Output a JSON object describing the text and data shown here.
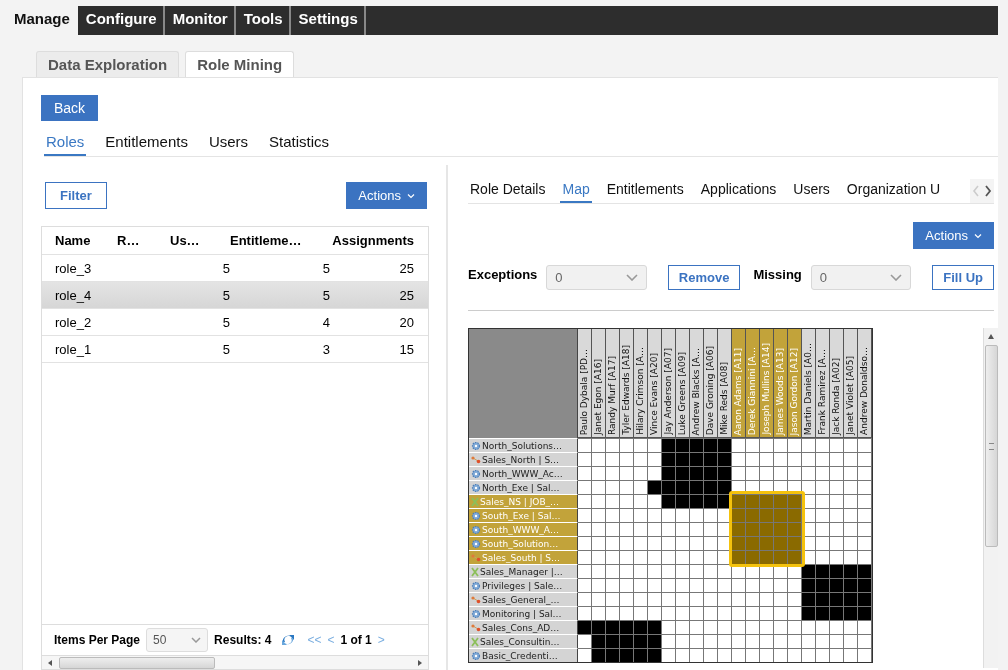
{
  "top_nav": [
    {
      "label": "Manage",
      "selected": true
    },
    {
      "label": "Configure",
      "selected": false
    },
    {
      "label": "Monitor",
      "selected": false
    },
    {
      "label": "Tools",
      "selected": false
    },
    {
      "label": "Settings",
      "selected": false
    }
  ],
  "sub_tabs": [
    {
      "label": "Data Exploration",
      "selected": false
    },
    {
      "label": "Role Mining",
      "selected": true
    }
  ],
  "back_button": "Back",
  "section_tabs": [
    {
      "label": "Roles",
      "selected": true
    },
    {
      "label": "Entitlements",
      "selected": false
    },
    {
      "label": "Users",
      "selected": false
    },
    {
      "label": "Statistics",
      "selected": false
    }
  ],
  "roles_panel": {
    "filter_button": "Filter",
    "actions_button": "Actions",
    "table": {
      "columns": [
        "Name",
        "R…",
        "Us…",
        "Entitleme…",
        "Assignments"
      ],
      "rows": [
        {
          "cells": [
            "role_3",
            "",
            "5",
            "5",
            "25"
          ],
          "selected": false
        },
        {
          "cells": [
            "role_4",
            "",
            "5",
            "5",
            "25"
          ],
          "selected": true
        },
        {
          "cells": [
            "role_2",
            "",
            "5",
            "4",
            "20"
          ],
          "selected": false
        },
        {
          "cells": [
            "role_1",
            "",
            "5",
            "3",
            "15"
          ],
          "selected": false
        }
      ]
    },
    "footer": {
      "items_per_page_label": "Items Per Page",
      "items_per_page": "50",
      "results": "Results: 4",
      "first": "<<",
      "prev": "<",
      "page": "1 of 1",
      "next": ">"
    }
  },
  "detail_panel": {
    "tabs": [
      {
        "label": "Role Details",
        "selected": false
      },
      {
        "label": "Map",
        "selected": true
      },
      {
        "label": "Entitlements",
        "selected": false
      },
      {
        "label": "Applications",
        "selected": false
      },
      {
        "label": "Users",
        "selected": false
      },
      {
        "label": "Organization U",
        "selected": false
      }
    ],
    "actions_button": "Actions",
    "exceptions": {
      "label": "Exceptions",
      "value": "0",
      "button": "Remove"
    },
    "missing": {
      "label": "Missing",
      "value": "0",
      "button": "Fill Up"
    },
    "matrix": {
      "columns": [
        {
          "label": "Paulo Dybala [PD…",
          "selected": false
        },
        {
          "label": "Janet Egon [A16]",
          "selected": false
        },
        {
          "label": "Randy Murf [A17]",
          "selected": false
        },
        {
          "label": "Tyler Edwards [A18]",
          "selected": false
        },
        {
          "label": "Hilary Crimson [A…",
          "selected": false
        },
        {
          "label": "Vince Evans [A20]",
          "selected": false
        },
        {
          "label": "Jay Anderson [A07]",
          "selected": false
        },
        {
          "label": "Luke Greens [A09]",
          "selected": false
        },
        {
          "label": "Andrew Blacks [A…",
          "selected": false
        },
        {
          "label": "Dave Groning [A06]",
          "selected": false
        },
        {
          "label": "Mike Reds [A08]",
          "selected": false
        },
        {
          "label": "Aaron Adams [A11]",
          "selected": true
        },
        {
          "label": "Derek Giannini [A…",
          "selected": true
        },
        {
          "label": "Joseph Mullins [A14]",
          "selected": true
        },
        {
          "label": "James Woods [A13]",
          "selected": true
        },
        {
          "label": "Jason Gordon [A12]",
          "selected": true
        },
        {
          "label": "Martin Daniels [A0…",
          "selected": false
        },
        {
          "label": "Frank Ramirez [A…",
          "selected": false
        },
        {
          "label": "Jack Ronda [A02]",
          "selected": false
        },
        {
          "label": "Janet Violet [A05]",
          "selected": false
        },
        {
          "label": "Andrew Donaldso…",
          "selected": false
        }
      ],
      "rows": [
        {
          "label": "North_Solutions…",
          "kind": "gear",
          "selected": false,
          "cells": [
            false,
            false,
            false,
            false,
            false,
            false,
            true,
            true,
            true,
            true,
            true,
            false,
            false,
            false,
            false,
            false,
            false,
            false,
            false,
            false,
            false
          ]
        },
        {
          "label": "Sales_North | S…",
          "kind": "dots",
          "selected": false,
          "cells": [
            false,
            false,
            false,
            false,
            false,
            false,
            true,
            true,
            true,
            true,
            true,
            false,
            false,
            false,
            false,
            false,
            false,
            false,
            false,
            false,
            false
          ]
        },
        {
          "label": "North_WWW_Ac…",
          "kind": "gear",
          "selected": false,
          "cells": [
            false,
            false,
            false,
            false,
            false,
            false,
            true,
            true,
            true,
            true,
            true,
            false,
            false,
            false,
            false,
            false,
            false,
            false,
            false,
            false,
            false
          ]
        },
        {
          "label": "North_Exe | Sal…",
          "kind": "gear",
          "selected": false,
          "cells": [
            false,
            false,
            false,
            false,
            false,
            true,
            true,
            true,
            true,
            true,
            true,
            false,
            false,
            false,
            false,
            false,
            false,
            false,
            false,
            false,
            false
          ]
        },
        {
          "label": "Sales_NS | JOB_…",
          "kind": "cross",
          "selected": true,
          "cells": [
            false,
            false,
            false,
            false,
            false,
            false,
            true,
            true,
            true,
            true,
            true,
            true,
            true,
            true,
            true,
            true,
            false,
            false,
            false,
            false,
            false
          ]
        },
        {
          "label": "South_Exe | Sal…",
          "kind": "gear",
          "selected": true,
          "cells": [
            false,
            false,
            false,
            false,
            false,
            false,
            false,
            false,
            false,
            false,
            false,
            true,
            true,
            true,
            true,
            true,
            false,
            false,
            false,
            false,
            false
          ]
        },
        {
          "label": "South_WWW_A…",
          "kind": "gear",
          "selected": true,
          "cells": [
            false,
            false,
            false,
            false,
            false,
            false,
            false,
            false,
            false,
            false,
            false,
            true,
            true,
            true,
            true,
            true,
            false,
            false,
            false,
            false,
            false
          ]
        },
        {
          "label": "South_Solution…",
          "kind": "gear",
          "selected": true,
          "cells": [
            false,
            false,
            false,
            false,
            false,
            false,
            false,
            false,
            false,
            false,
            false,
            true,
            true,
            true,
            true,
            true,
            false,
            false,
            false,
            false,
            false
          ]
        },
        {
          "label": "Sales_South | S…",
          "kind": "dots",
          "selected": true,
          "cells": [
            false,
            false,
            false,
            false,
            false,
            false,
            false,
            false,
            false,
            false,
            false,
            true,
            true,
            true,
            true,
            true,
            false,
            false,
            false,
            false,
            false
          ]
        },
        {
          "label": "Sales_Manager |…",
          "kind": "cross",
          "selected": false,
          "cells": [
            false,
            false,
            false,
            false,
            false,
            false,
            false,
            false,
            false,
            false,
            false,
            false,
            false,
            false,
            false,
            false,
            true,
            true,
            true,
            true,
            true
          ]
        },
        {
          "label": "Privileges | Sale…",
          "kind": "gear",
          "selected": false,
          "cells": [
            false,
            false,
            false,
            false,
            false,
            false,
            false,
            false,
            false,
            false,
            false,
            false,
            false,
            false,
            false,
            false,
            true,
            true,
            true,
            true,
            true
          ]
        },
        {
          "label": "Sales_General_…",
          "kind": "dots",
          "selected": false,
          "cells": [
            false,
            false,
            false,
            false,
            false,
            false,
            false,
            false,
            false,
            false,
            false,
            false,
            false,
            false,
            false,
            false,
            true,
            true,
            true,
            true,
            true
          ]
        },
        {
          "label": "Monitoring | Sal…",
          "kind": "gear",
          "selected": false,
          "cells": [
            false,
            false,
            false,
            false,
            false,
            false,
            false,
            false,
            false,
            false,
            false,
            false,
            false,
            false,
            false,
            false,
            true,
            true,
            true,
            true,
            true
          ]
        },
        {
          "label": "Sales_Cons_AD…",
          "kind": "dots",
          "selected": false,
          "cells": [
            true,
            true,
            true,
            true,
            true,
            true,
            false,
            false,
            false,
            false,
            false,
            false,
            false,
            false,
            false,
            false,
            false,
            false,
            false,
            false,
            false
          ]
        },
        {
          "label": "Sales_Consultin…",
          "kind": "cross",
          "selected": false,
          "cells": [
            false,
            true,
            true,
            true,
            true,
            true,
            false,
            false,
            false,
            false,
            false,
            false,
            false,
            false,
            false,
            false,
            false,
            false,
            false,
            false,
            false
          ]
        },
        {
          "label": "Basic_Credenti…",
          "kind": "gear",
          "selected": false,
          "cells": [
            false,
            true,
            true,
            true,
            true,
            true,
            false,
            false,
            false,
            false,
            false,
            false,
            false,
            false,
            false,
            false,
            false,
            false,
            false,
            false,
            false
          ]
        }
      ]
    }
  }
}
